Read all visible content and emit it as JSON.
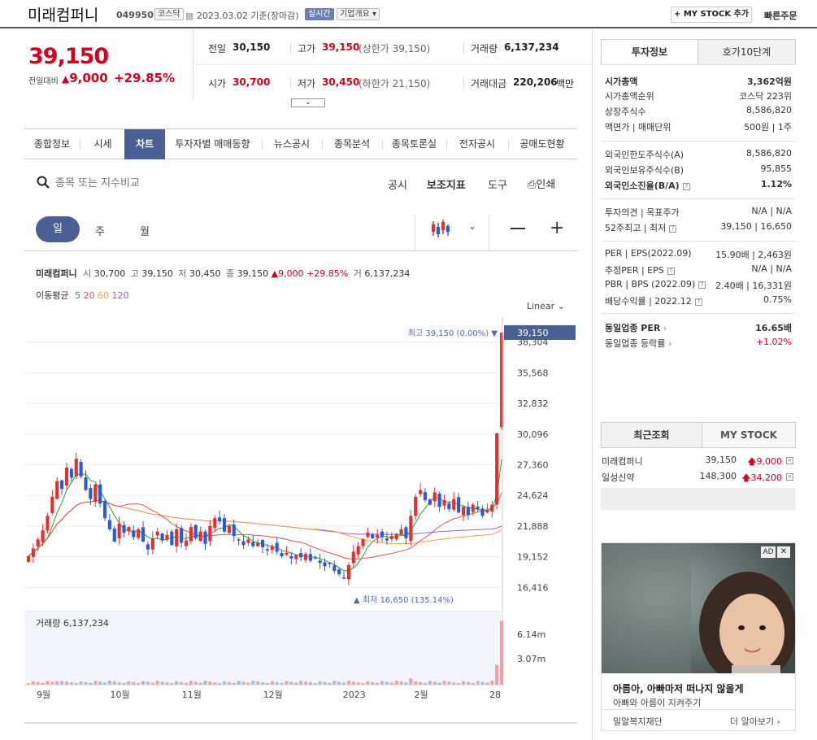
{
  "header": {
    "stock_name": "미래컴퍼니",
    "stock_code": "049950",
    "market": "코스닥",
    "date": "2023.03.02 기준(장마감)",
    "realtime": "실시간",
    "company_info": "기업개요",
    "mystock_add": "+ MY STOCK 추가",
    "quick_order": "빠른주문"
  },
  "price": {
    "current": "39,150",
    "prev_label": "전일대비",
    "change": "9,000",
    "change_pct": "+29.85%"
  },
  "quote": {
    "prev_label": "전일",
    "prev": "30,150",
    "high_label": "고가",
    "high": "39,150",
    "upper_limit": "(상한가 39,150)",
    "volume_label": "거래량",
    "volume": "6,137,234",
    "open_label": "시가",
    "open": "30,700",
    "low_label": "저가",
    "low": "30,450",
    "lower_limit": "(하한가 21,150)",
    "amount_label": "거래대금",
    "amount": "220,206",
    "amount_unit": "백만"
  },
  "tabs": [
    "종합정보",
    "시세",
    "차트",
    "투자자별 매매동향",
    "뉴스공시",
    "종목분석",
    "종목토론실",
    "전자공시",
    "공매도현황"
  ],
  "toolbar": {
    "search_placeholder": "종목 또는 지수비교",
    "notice": "공시",
    "indicators": "보조지표",
    "tools": "도구",
    "print": "인쇄"
  },
  "period": {
    "day": "일",
    "week": "주",
    "month": "월"
  },
  "chart_info": {
    "name": "미래컴퍼니",
    "open_l": "시",
    "open": "30,700",
    "high_l": "고",
    "high": "39,150",
    "low_l": "저",
    "low": "30,450",
    "close_l": "종",
    "close": "39,150",
    "chg": "▲9,000",
    "pct": "+29.85%",
    "vol_l": "거",
    "vol": "6,137,234"
  },
  "ma": {
    "label": "이동평균",
    "p5": "5",
    "p20": "20",
    "p60": "60",
    "p120": "120",
    "c5": "#2ca02c",
    "c20": "#e05050",
    "c60": "#f0a050",
    "c120": "#9b5fd6"
  },
  "scale_mode": "Linear",
  "chart_data": {
    "type": "candlestick",
    "y_ticks": [
      "38,304",
      "35,568",
      "32,832",
      "30,096",
      "27,360",
      "24,624",
      "21,888",
      "19,152",
      "16,416"
    ],
    "x_ticks": [
      "9월",
      "10월",
      "11월",
      "12월",
      "2023",
      "2월",
      "28"
    ],
    "current_label": "39,150",
    "max_label": "최고 39,150 (0.00%)",
    "min_label": "최저 16,650 (135.14%)",
    "volume_label": "거래량",
    "volume_value": "6,137,234",
    "vol_ticks": [
      "6.14m",
      "3.07m"
    ],
    "closes": [
      19200,
      19900,
      20700,
      21500,
      22800,
      24500,
      25900,
      25200,
      27100,
      26200,
      27900,
      26300,
      25100,
      24300,
      25600,
      23900,
      22600,
      21600,
      20500,
      22100,
      21300,
      21800,
      20900,
      21600,
      20500,
      19800,
      20800,
      21400,
      20600,
      21100,
      20200,
      21600,
      20400,
      20600,
      21800,
      20800,
      21400,
      20300,
      21900,
      22600,
      22300,
      21400,
      21900,
      21000,
      20600,
      20200,
      20700,
      20100,
      20400,
      20000,
      19700,
      20100,
      19600,
      19200,
      19500,
      19000,
      19300,
      19100,
      19400,
      18800,
      19000,
      18600,
      18300,
      18500,
      17900,
      17600,
      17200,
      18400,
      19600,
      20100,
      20700,
      21300,
      20800,
      21100,
      20900,
      20600,
      21000,
      21200,
      21600,
      20800,
      22800,
      24500,
      25100,
      24200,
      23800,
      24900,
      23600,
      24200,
      23400,
      24300,
      23100,
      23600,
      22900,
      23800,
      23400,
      22800,
      23300,
      23800,
      30150,
      39150
    ]
  },
  "invest": {
    "tab1": "투자정보",
    "tab2": "호가10단계",
    "rows": [
      [
        "시가총액",
        "3,362억원"
      ],
      [
        "시가총액순위",
        "코스닥 223위"
      ],
      [
        "상장주식수",
        "8,586,820"
      ],
      [
        "액면가 | 매매단위",
        "500원 | 1주"
      ],
      [
        "외국인한도주식수(A)",
        "8,586,820"
      ],
      [
        "외국인보유주식수(B)",
        "95,855"
      ],
      [
        "외국인소진율(B/A)",
        "1.12%"
      ],
      [
        "투자의견 | 목표주가",
        "N/A | N/A"
      ],
      [
        "52주최고 | 최저",
        "39,150 | 16,650"
      ],
      [
        "PER | EPS(2022.09)",
        "15.90배 | 2,463원"
      ],
      [
        "추정PER | EPS",
        "N/A | N/A"
      ],
      [
        "PBR | BPS (2022.09)",
        "2.40배 | 16,331원"
      ],
      [
        "배당수익률 | 2022.12",
        "0.75%"
      ],
      [
        "동일업종 PER",
        "16.65배"
      ],
      [
        "동일업종 등락률",
        "+1.02%"
      ]
    ]
  },
  "recent": {
    "tab1": "최근조회",
    "tab2": "MY STOCK",
    "items": [
      {
        "name": "미래컴퍼니",
        "price": "39,150",
        "chg": "9,000"
      },
      {
        "name": "일성신약",
        "price": "148,300",
        "chg": "34,200"
      }
    ]
  },
  "ad": {
    "badge": "AD",
    "title": "아름아, 아빠마저 떠나지 않을게",
    "sub": "아빠와 아름이 지켜주기",
    "org": "밀알복지재단",
    "more": "더 알아보기 ›"
  }
}
